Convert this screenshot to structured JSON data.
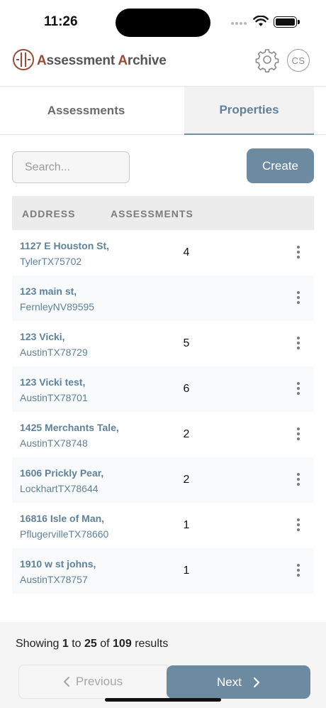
{
  "status_bar": {
    "time": "11:26"
  },
  "header": {
    "title_parts": [
      {
        "text": "A",
        "accent": true
      },
      {
        "text": "ssessment ",
        "accent": false
      },
      {
        "text": "A",
        "accent": true
      },
      {
        "text": "rchive",
        "accent": false
      }
    ],
    "avatar_initials": "CS",
    "settings_icon": "gear-icon",
    "logo_icon": "circle-logo-icon"
  },
  "tabs": [
    {
      "label": "Assessments",
      "active": false
    },
    {
      "label": "Properties",
      "active": true
    }
  ],
  "toolbar": {
    "search_placeholder": "Search...",
    "search_value": "",
    "create_label": "Create"
  },
  "table": {
    "columns": [
      "ADDRESS",
      "ASSESSMENTS"
    ],
    "rows": [
      {
        "street": "1127 E Houston St,",
        "city": "TylerTX75702",
        "count": "4"
      },
      {
        "street": "123 main st,",
        "city": "FernleyNV89595",
        "count": ""
      },
      {
        "street": "123 Vicki,",
        "city": "AustinTX78729",
        "count": "5"
      },
      {
        "street": "123 Vicki test,",
        "city": "AustinTX78701",
        "count": "6"
      },
      {
        "street": "1425 Merchants Tale,",
        "city": "AustinTX78748",
        "count": "2"
      },
      {
        "street": "1606 Prickly Pear,",
        "city": "LockhartTX78644",
        "count": "2"
      },
      {
        "street": "16816 Isle of Man,",
        "city": "PflugervilleTX78660",
        "count": "1"
      },
      {
        "street": "1910 w st johns,",
        "city": "AustinTX78757",
        "count": "1"
      }
    ]
  },
  "pagination": {
    "showing_label": "Showing",
    "from": "1",
    "to_label": "to",
    "to": "25",
    "of_label": "of",
    "total": "109",
    "results_label": "results",
    "previous_label": "Previous",
    "next_label": "Next"
  },
  "colors": {
    "accent_blue": "#6d8ba0",
    "link_blue": "#5f8299",
    "brand_red": "#9a4b38"
  }
}
